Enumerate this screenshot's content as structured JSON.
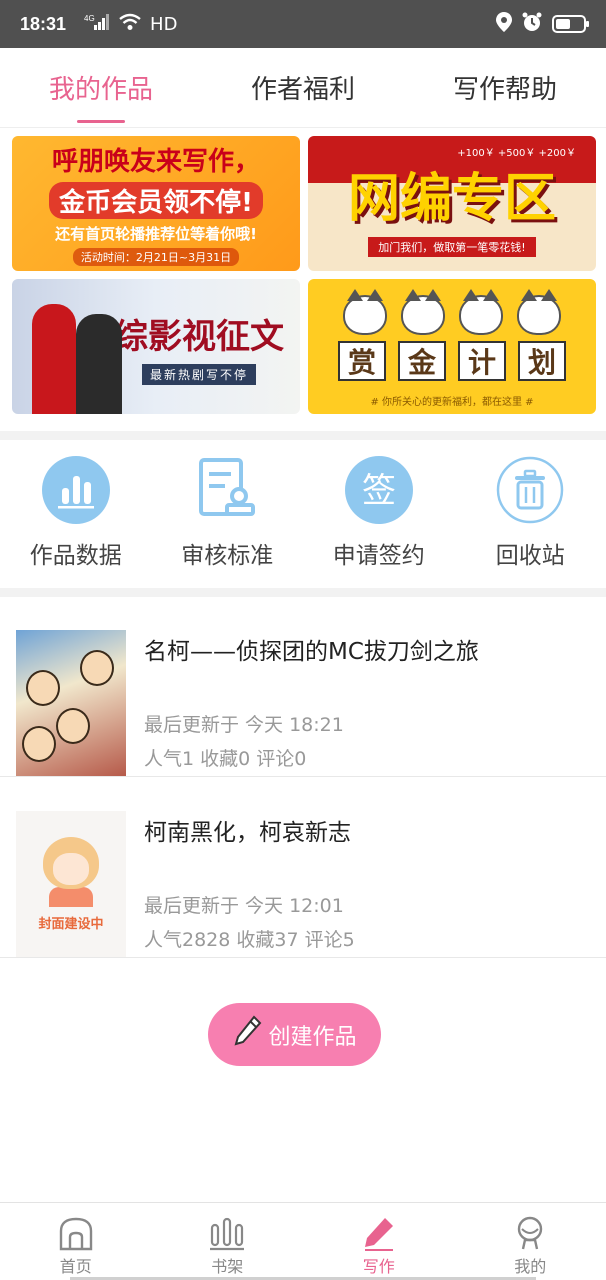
{
  "status_bar": {
    "time": "18:31",
    "network": "4G",
    "wifi_label": "HD",
    "battery_level": 0.55,
    "icons": [
      "signal-icon",
      "wifi-icon",
      "location-icon",
      "alarm-icon",
      "battery-icon"
    ]
  },
  "tabs": [
    {
      "label": "我的作品",
      "active": true
    },
    {
      "label": "作者福利",
      "active": false
    },
    {
      "label": "写作帮助",
      "active": false
    }
  ],
  "banners": {
    "b1": {
      "line1": "呼朋唤友来写作，",
      "line2": "金币会员领不停!",
      "line3": "还有首页轮播推荐位等着你哦!",
      "line4": "活动时间：2月21日~3月31日"
    },
    "b2": {
      "title": "网编专区",
      "subtitle": "加门我们，做取第一笔零花钱!",
      "note": "+100￥ +500￥ +200￥"
    },
    "b3": {
      "title": "综影视征文",
      "subtitle": "最新热剧写不停"
    },
    "b4": {
      "chars": [
        "赏",
        "金",
        "计",
        "划"
      ],
      "note": "# 你所关心的更新福利，都在这里 #"
    }
  },
  "shortcuts": [
    {
      "label": "作品数据",
      "icon": "bar-chart-icon"
    },
    {
      "label": "审核标准",
      "icon": "document-stamp-icon"
    },
    {
      "label": "申请签约",
      "icon": "sign-icon"
    },
    {
      "label": "回收站",
      "icon": "trash-icon"
    }
  ],
  "works": [
    {
      "title": "名柯——侦探团的MC拔刀剑之旅",
      "updated": "最后更新于 今天 18:21",
      "stats": "人气1 收藏0 评论0"
    },
    {
      "title": "柯南黑化，柯哀新志",
      "updated": "最后更新于 今天 12:01",
      "stats": "人气2828 收藏37 评论5",
      "cover_text": "封面建设中"
    }
  ],
  "create_button": {
    "label": "创建作品",
    "icon": "pencil-icon"
  },
  "bottom_nav": [
    {
      "label": "首页",
      "icon": "home-icon",
      "active": false
    },
    {
      "label": "书架",
      "icon": "bookshelf-icon",
      "active": false
    },
    {
      "label": "写作",
      "icon": "pen-icon",
      "active": true
    },
    {
      "label": "我的",
      "icon": "profile-icon",
      "active": false
    }
  ],
  "colors": {
    "accent": "#e8638f",
    "create_button": "#f77fb0",
    "icon_blue": "#8fc8ef"
  }
}
